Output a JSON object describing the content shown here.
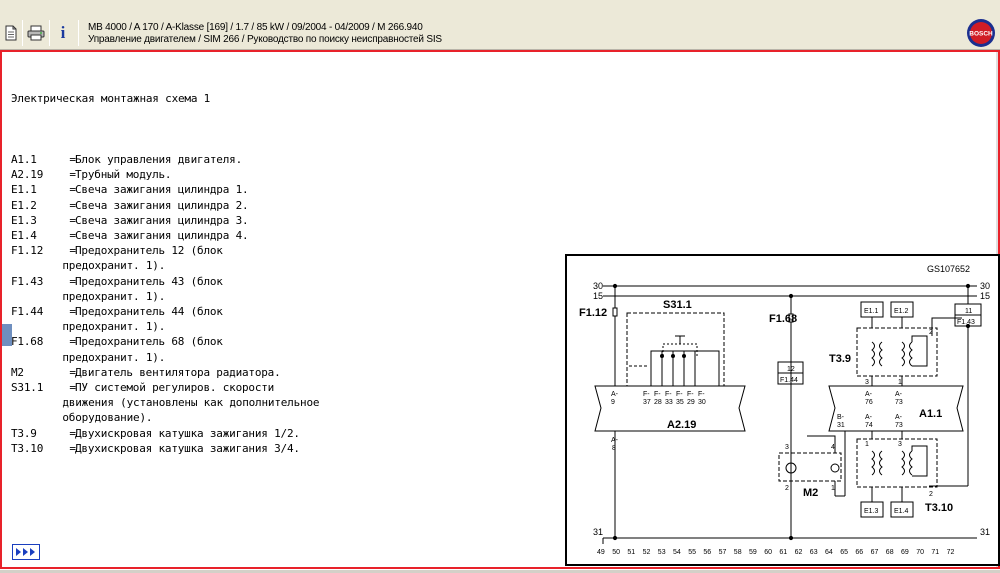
{
  "header": {
    "line1": "MB 4000 / A 170 / A-Klasse [169] / 1.7 / 85 kW / 09/2004 - 04/2009 / M 266.940",
    "line2": "Управление двигателем / SIM 266 / Руководство по поиску неисправностей SIS",
    "logo_text": "BOSCH"
  },
  "toolbar_icons": [
    "document-icon",
    "printer-icon",
    "info-icon"
  ],
  "info_label": "i",
  "content": {
    "title": "Электрическая монтажная схема 1",
    "legend": [
      {
        "code": "A1.1",
        "text": "Блок управления двигателя."
      },
      {
        "code": "A2.19",
        "text": "Трубный модуль."
      },
      {
        "code": "E1.1",
        "text": "Свеча зажигания цилиндра 1."
      },
      {
        "code": "E1.2",
        "text": "Свеча зажигания цилиндра 2."
      },
      {
        "code": "E1.3",
        "text": "Свеча зажигания цилиндра 3."
      },
      {
        "code": "E1.4",
        "text": "Свеча зажигания цилиндра 4."
      },
      {
        "code": "F1.12",
        "text": "Предохранитель 12 (блок\n        предохранит. 1)."
      },
      {
        "code": "F1.43",
        "text": "Предохранитель 43 (блок\n        предохранит. 1)."
      },
      {
        "code": "F1.44",
        "text": "Предохранитель 44 (блок\n        предохранит. 1)."
      },
      {
        "code": "F1.68",
        "text": "Предохранитель 68 (блок\n        предохранит. 1)."
      },
      {
        "code": "M2",
        "text": "Двигатель вентилятора радиатора."
      },
      {
        "code": "S31.1",
        "text": "ПУ системой регулиров. скорости\n        движения (установлены как дополнительное\n        оборудование)."
      },
      {
        "code": "T3.9",
        "text": "Двухискровая катушка зажигания 1/2."
      },
      {
        "code": "T3.10",
        "text": "Двухискровая катушка зажигания 3/4."
      }
    ],
    "next_icon": "triple-arrow-right-icon"
  },
  "diagram": {
    "id": "GS107652",
    "rails": [
      "30",
      "15"
    ],
    "ground": "31",
    "labels": {
      "f1_12": "F1.12",
      "f1_68": "F1.68",
      "s31_1": "S31.1",
      "t3_9": "T3.9",
      "t3_10": "T3.10",
      "a1_1": "A1.1",
      "a2_19": "A2.19",
      "m2": "M2",
      "e1_1": "E1.1",
      "e1_2": "E1.2",
      "e1_3": "E1.3",
      "e1_4": "E1.4",
      "f1_44": "F1.44",
      "f1_43": "F1.43",
      "fuse12": "12",
      "fuse11": "11"
    },
    "a2_19_pins_top": [
      {
        "t": "A-",
        "n": "9"
      },
      {
        "t": "F-",
        "n": "37"
      },
      {
        "t": "F-",
        "n": "28"
      },
      {
        "t": "F-",
        "n": "33"
      },
      {
        "t": "F-",
        "n": "35"
      },
      {
        "t": "F-",
        "n": "29"
      },
      {
        "t": "F-",
        "n": "30"
      }
    ],
    "a2_19_pin_bottom": {
      "t": "A-",
      "n": "8"
    },
    "a1_1_pins_top": [
      {
        "t": "A-",
        "n": "76"
      },
      {
        "t": "A-",
        "n": "73"
      }
    ],
    "a1_1_pins_bottom": [
      {
        "t": "B-",
        "n": "31"
      },
      {
        "t": "A-",
        "n": "74"
      },
      {
        "t": "A-",
        "n": "73"
      }
    ],
    "coil_pins": {
      "t39_a": "3",
      "t39_b": "1",
      "t39_c": "2",
      "t310_a": "1",
      "t310_b": "3",
      "t310_c": "2"
    },
    "m2_pins": {
      "p3": "3",
      "p4": "4",
      "p2": "2",
      "p1": "1"
    },
    "scale": [
      "49",
      "50",
      "51",
      "52",
      "53",
      "54",
      "55",
      "56",
      "57",
      "58",
      "59",
      "60",
      "61",
      "62",
      "63",
      "64",
      "65",
      "66",
      "67",
      "68",
      "69",
      "70",
      "71",
      "72"
    ]
  }
}
